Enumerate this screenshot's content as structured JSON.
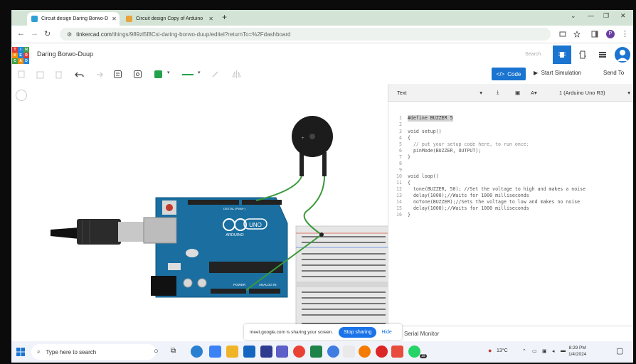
{
  "browser": {
    "tabs": [
      {
        "title": "Circuit design Daring Borwo-D",
        "active": true,
        "favicon_color": "#2ea0d8"
      },
      {
        "title": "Circuit design Copy of Arduino",
        "active": false,
        "favicon_color": "#e8a33a"
      }
    ],
    "url_host": "tinkercad.com",
    "url_path": "/things/989zl5f8Csi-daring-borwo-duup/editel?returnTo=%2Fdashboard",
    "profile_initial": "P"
  },
  "app": {
    "logo_letters": [
      "TIN",
      "KER",
      "CAD"
    ],
    "project_name": "Daring Borwo-Duup",
    "search_placeholder": "Search"
  },
  "toolbar": {
    "code_label": "Code",
    "simulate_label": "Start Simulation",
    "send_label": "Send To",
    "component_color": "#22a34a",
    "wire_color": "#22a34a"
  },
  "code_panel": {
    "mode": "Text",
    "device": "1 (Arduino Uno R3)",
    "lines": [
      {
        "n": "1",
        "text": "#define BUZZER 5",
        "highlight": true
      },
      {
        "n": "2",
        "text": ""
      },
      {
        "n": "3",
        "text": "void setup()"
      },
      {
        "n": "4",
        "text": "{"
      },
      {
        "n": "5",
        "text": "  // put your setup code here, to run once:",
        "comment": true
      },
      {
        "n": "6",
        "text": "  pinMode(BUZZER, OUTPUT);"
      },
      {
        "n": "7",
        "text": "}"
      },
      {
        "n": "8",
        "text": ""
      },
      {
        "n": "9",
        "text": ""
      },
      {
        "n": "10",
        "text": "void loop()"
      },
      {
        "n": "11",
        "text": "{"
      },
      {
        "n": "12",
        "text": "  tone(BUZZER, 50); //Set the voltage to high and makes a noise"
      },
      {
        "n": "13",
        "text": "  delay(1000);//Waits for 1000 milliseconds"
      },
      {
        "n": "14",
        "text": "  noTone(BUZZER);//Sets the voltage to low and makes no noise"
      },
      {
        "n": "15",
        "text": "  delay(1000);//Waits for 1000 milliseconds"
      },
      {
        "n": "16",
        "text": "}"
      }
    ],
    "serial_monitor_label": "Serial Monitor"
  },
  "board": {
    "brand_label": "ARDUINO",
    "model_label": "UNO",
    "digital_label": "DIGITAL (PWM~)",
    "power_label": "POWER",
    "analog_label": "ANALOG IN"
  },
  "share_banner": {
    "text": "meet.google.com is sharing your screen.",
    "stop_label": "Stop sharing",
    "hide_label": "Hide"
  },
  "taskbar": {
    "search_placeholder": "Type here to search",
    "temperature": "13°C",
    "time": "8:29 PM",
    "date": "1/4/2024",
    "badge_count": "19"
  }
}
